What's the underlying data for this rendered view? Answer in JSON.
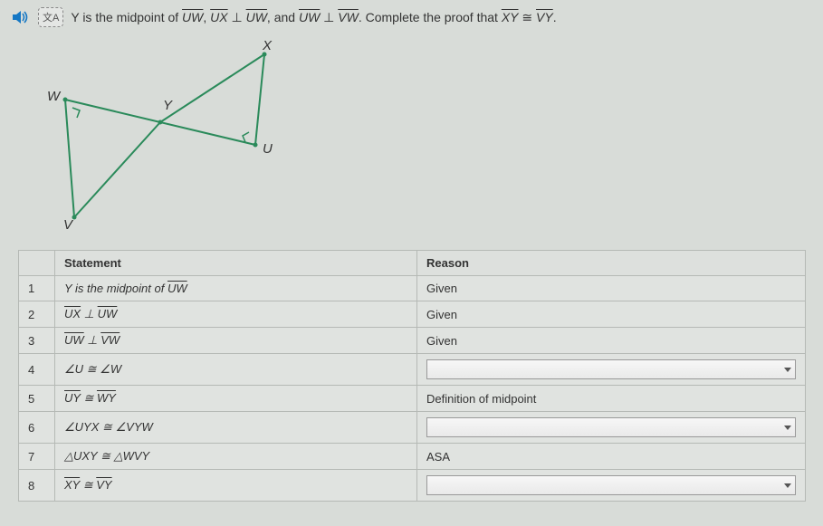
{
  "prompt": {
    "prefix": "Y is the midpoint of ",
    "seg1": "UW",
    "mid1": ", ",
    "seg2": "UX",
    "perp1": " ⊥ ",
    "seg3": "UW",
    "mid2": ", and ",
    "seg4": "UW",
    "perp2": " ⊥ ",
    "seg5": "VW",
    "mid3": ". Complete the proof that ",
    "seg6": "XY",
    "cong": " ≅ ",
    "seg7": "VY",
    "end": "."
  },
  "diagram": {
    "points": {
      "X": "X",
      "U": "U",
      "W": "W",
      "Y": "Y",
      "V": "V"
    }
  },
  "table": {
    "headers": {
      "stmt": "Statement",
      "reason": "Reason"
    },
    "rows": [
      {
        "n": "1",
        "stmt_pre": "Y is the midpoint of ",
        "stmt_seg": "UW",
        "reason_text": "Given",
        "reason_select": false
      },
      {
        "n": "2",
        "stmt_html": "UX ⊥ UW",
        "seg_a": "UX",
        "op": " ⊥ ",
        "seg_b": "UW",
        "reason_text": "Given",
        "reason_select": false
      },
      {
        "n": "3",
        "seg_a": "UW",
        "op": " ⊥ ",
        "seg_b": "VW",
        "reason_text": "Given",
        "reason_select": false
      },
      {
        "n": "4",
        "plain": "∠U ≅ ∠W",
        "reason_text": "",
        "reason_select": true
      },
      {
        "n": "5",
        "seg_a": "UY",
        "op": " ≅ ",
        "seg_b": "WY",
        "reason_text": "Definition of midpoint",
        "reason_select": false
      },
      {
        "n": "6",
        "plain": "∠UYX ≅ ∠VYW",
        "reason_text": "",
        "reason_select": true
      },
      {
        "n": "7",
        "plain": "△UXY ≅ △WVY",
        "reason_text": "ASA",
        "reason_select": false
      },
      {
        "n": "8",
        "seg_a": "XY",
        "op": " ≅ ",
        "seg_b": "VY",
        "reason_text": "",
        "reason_select": true
      }
    ]
  }
}
